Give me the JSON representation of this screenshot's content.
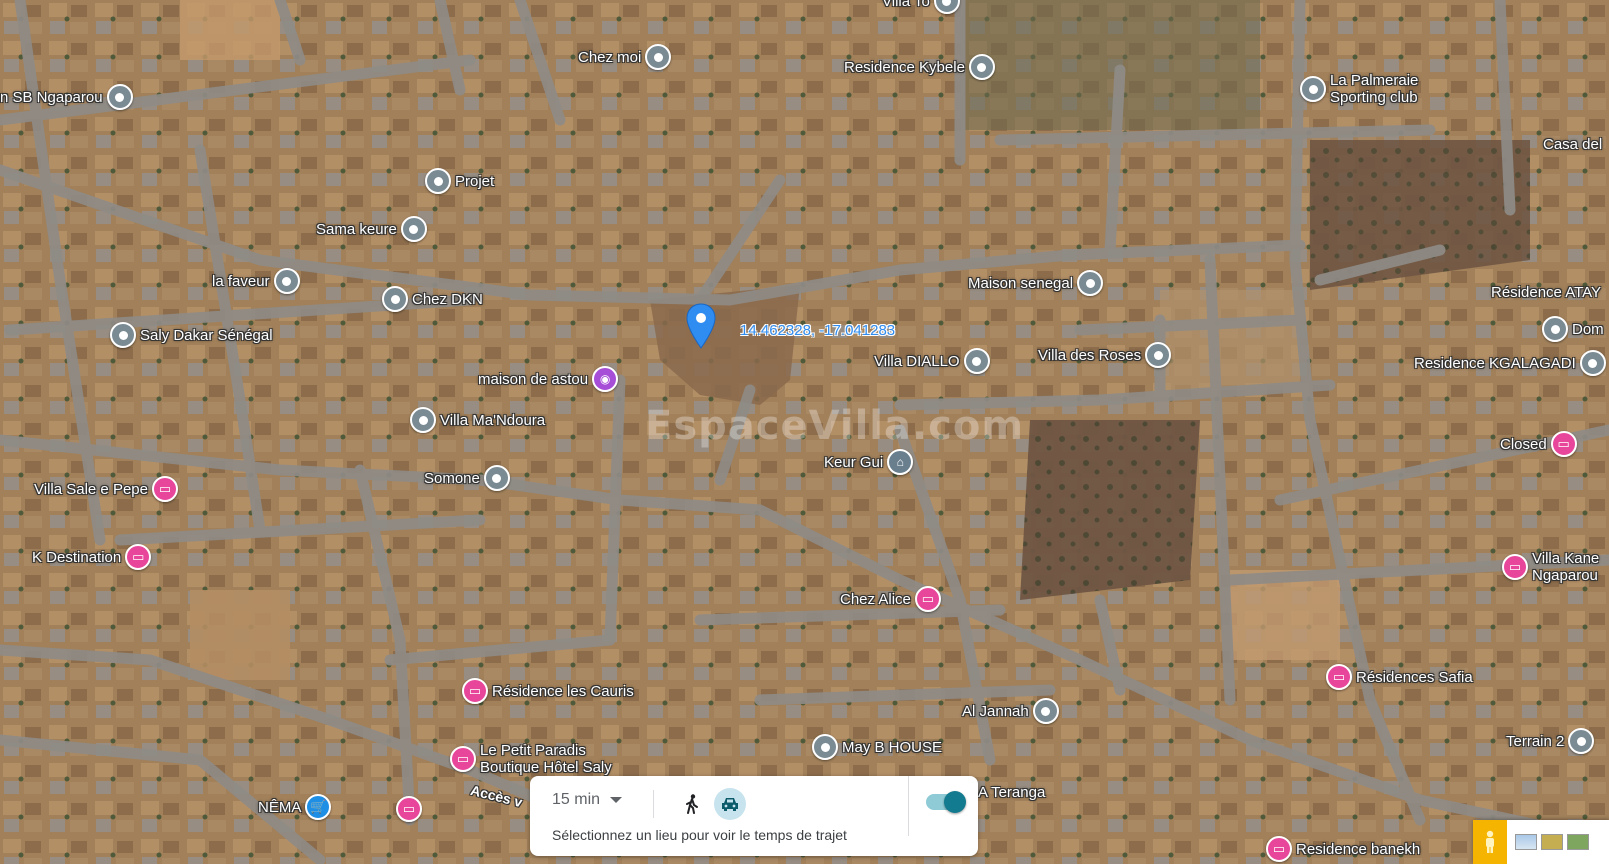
{
  "map": {
    "dropped_pin": {
      "coordinates": "14.462328, -17.041283"
    },
    "watermark": "EspaceVilla.com",
    "road_label": "Accès v",
    "pois": [
      {
        "id": "villa-to",
        "label": "Villa To",
        "icon": "place-pin"
      },
      {
        "id": "sb-ngaparou",
        "label": "n SB Ngaparou",
        "icon": "place-pin"
      },
      {
        "id": "chez-moi",
        "label": "Chez moi",
        "icon": "place-pin"
      },
      {
        "id": "residence-kybele",
        "label": "Residence Kybele",
        "icon": "place-pin"
      },
      {
        "id": "la-palmeraie",
        "label": "La Palmeraie Sporting club",
        "icon": "place-pin"
      },
      {
        "id": "casa-del",
        "label": "Casa del",
        "icon": "none"
      },
      {
        "id": "projet",
        "label": "Projet",
        "icon": "place-pin"
      },
      {
        "id": "sama-keure",
        "label": "Sama keure",
        "icon": "place-pin"
      },
      {
        "id": "la-faveur",
        "label": "la faveur",
        "icon": "place-pin"
      },
      {
        "id": "chez-dkn",
        "label": "Chez DKN",
        "icon": "place-pin"
      },
      {
        "id": "maison-senegal",
        "label": "Maison senegal",
        "icon": "place-pin"
      },
      {
        "id": "residence-atay",
        "label": "Résidence ATAY",
        "icon": "none"
      },
      {
        "id": "saly-dakar",
        "label": "Saly Dakar Sénégal",
        "icon": "place-pin"
      },
      {
        "id": "dom",
        "label": "Dom",
        "icon": "place-pin"
      },
      {
        "id": "villa-diallo",
        "label": "Villa DIALLO",
        "icon": "place-pin"
      },
      {
        "id": "villa-des-roses",
        "label": "Villa des Roses",
        "icon": "place-pin"
      },
      {
        "id": "residence-kgalagadi",
        "label": "Residence KGALAGADI",
        "icon": "place-pin"
      },
      {
        "id": "maison-de-astou",
        "label": "maison de astou",
        "icon": "camera"
      },
      {
        "id": "villa-mandoura",
        "label": "Villa Ma'Ndoura",
        "icon": "place-pin"
      },
      {
        "id": "closed",
        "label": "Closed",
        "icon": "hotel"
      },
      {
        "id": "keur-gui",
        "label": "Keur Gui",
        "icon": "bank"
      },
      {
        "id": "somone",
        "label": "Somone",
        "icon": "place-pin"
      },
      {
        "id": "villa-sale-e-pepe",
        "label": "Villa Sale e Pepe",
        "icon": "hotel"
      },
      {
        "id": "k-destination",
        "label": "K Destination",
        "icon": "hotel"
      },
      {
        "id": "villa-kane",
        "label": "Villa Kane Ngaparou",
        "icon": "hotel"
      },
      {
        "id": "chez-alice",
        "label": "Chez Alice",
        "icon": "hotel"
      },
      {
        "id": "residences-safia",
        "label": "Résidences Safia",
        "icon": "hotel"
      },
      {
        "id": "residence-les-cauris",
        "label": "Résidence les Cauris",
        "icon": "hotel"
      },
      {
        "id": "al-jannah",
        "label": "Al Jannah",
        "icon": "place-pin"
      },
      {
        "id": "terrain-2",
        "label": "Terrain 2",
        "icon": "place-pin"
      },
      {
        "id": "le-petit-paradis",
        "label": "Le Petit Paradis Boutique Hôtel Saly",
        "icon": "hotel"
      },
      {
        "id": "may-b-house",
        "label": "May B HOUSE",
        "icon": "place-pin"
      },
      {
        "id": "teranga",
        "label": "A Teranga",
        "icon": "none"
      },
      {
        "id": "nema",
        "label": "NÊMA",
        "icon": "shopping-cart"
      },
      {
        "id": "hotel-bottom",
        "label": "",
        "icon": "hotel"
      },
      {
        "id": "residence-banekh",
        "label": "Residence banekh",
        "icon": "hotel"
      }
    ]
  },
  "travel_panel": {
    "time": "15 min",
    "hint": "Sélectionnez un lieu pour voir le temps de trajet",
    "modes": [
      "walk-icon",
      "car-icon"
    ],
    "selected_mode": "car-icon",
    "toggle_on": true
  },
  "colors": {
    "terrain": "#9c7a55",
    "road": "#8f8b86",
    "pin_gray": "#7b8b94",
    "pin_hotel": "#e8469a",
    "coords_blue": "#2f8cf0"
  }
}
